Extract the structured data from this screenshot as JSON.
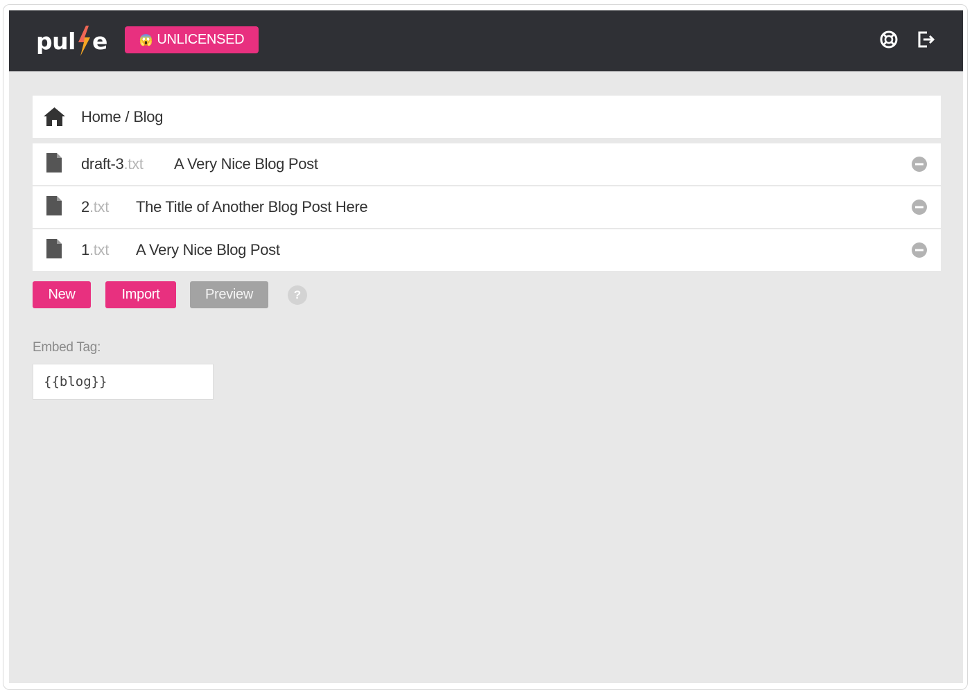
{
  "header": {
    "logo_left": "pul",
    "logo_right": "e",
    "license_emoji": "😱",
    "license_badge": "UNLICENSED",
    "help_icon": "lifebuoy-icon",
    "logout_icon": "sign-out-icon",
    "colors": {
      "bar": "#2f3035",
      "accent": "#e8307f",
      "bolt": "#f5a623"
    }
  },
  "breadcrumb": {
    "home_icon": "home-icon",
    "home": "Home",
    "separator": "/",
    "current": "Blog"
  },
  "files": [
    {
      "name": "draft-3",
      "ext": ".txt",
      "title": "A Very Nice Blog Post"
    },
    {
      "name": "2",
      "ext": ".txt",
      "title": "The Title of Another Blog Post Here"
    },
    {
      "name": "1",
      "ext": ".txt",
      "title": "A Very Nice Blog Post"
    }
  ],
  "actions": {
    "new_label": "New",
    "import_label": "Import",
    "preview_label": "Preview",
    "help_label": "?"
  },
  "embed": {
    "label": "Embed Tag:",
    "value": "{{blog}}"
  }
}
